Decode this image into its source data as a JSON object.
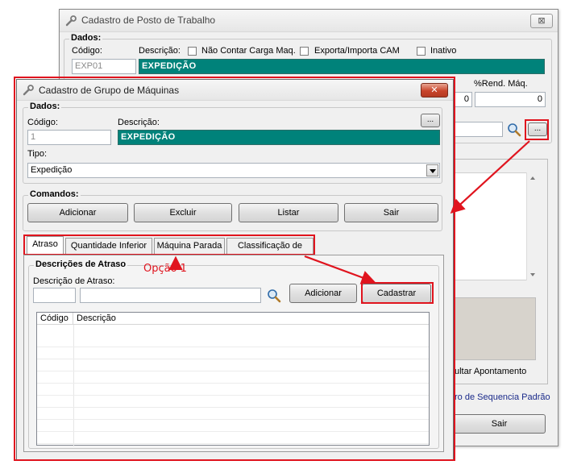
{
  "back_window": {
    "title": "Cadastro de Posto de Trabalho",
    "close_glyph": "⊠",
    "dados_title": "Dados:",
    "codigo_label": "Código:",
    "codigo_value": "EXP01",
    "descricao_label": "Descrição:",
    "chk_nao_contar": "Não Contar Carga Maq.",
    "chk_exporta": "Exporta/Importa CAM",
    "chk_inativo": "Inativo",
    "descricao_value": "EXPEDIÇÃO",
    "rend_label": "%Rend. Máq.",
    "num_value_1": "0",
    "num_value_2": "0",
    "ellipsis": "...",
    "consultar_text": "ultar Apontamento",
    "link_text": "ro de Sequencia Padrão",
    "sair_label": "Sair"
  },
  "front_window": {
    "title": "Cadastro de Grupo de Máquinas",
    "close_glyph": "✕",
    "dados_title": "Dados:",
    "codigo_label": "Código:",
    "descricao_label": "Descrição:",
    "codigo_value": "1",
    "descricao_value": "EXPEDIÇÃO",
    "ellipsis": "...",
    "tipo_label": "Tipo:",
    "tipo_value": "Expedição",
    "comandos_title": "Comandos:",
    "btn_adicionar": "Adicionar",
    "btn_excluir": "Excluir",
    "btn_listar": "Listar",
    "btn_sair": "Sair",
    "tabs": [
      "Atraso",
      "Quantidade Inferior",
      "Máquina Parada",
      "Classificação de RNC"
    ],
    "atraso_group_title": "Descrições de Atraso",
    "desc_atraso_label": "Descrição de Atraso:",
    "btn_adicionar2": "Adicionar",
    "btn_cadastrar": "Cadastrar",
    "col_codigo": "Código",
    "col_descricao": "Descrição"
  },
  "annotation": {
    "label": "Opção 1",
    "color": "#e0141e"
  }
}
